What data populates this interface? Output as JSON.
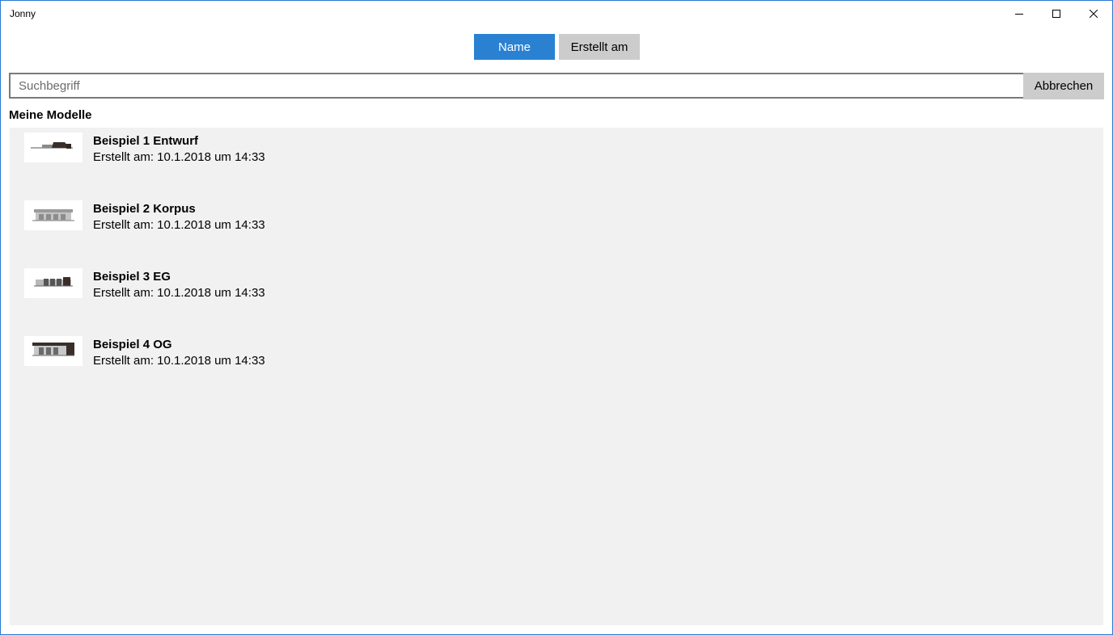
{
  "window": {
    "title": "Jonny"
  },
  "sort": {
    "name_label": "Name",
    "date_label": "Erstellt am"
  },
  "search": {
    "placeholder": "Suchbegriff",
    "cancel_label": "Abbrechen"
  },
  "section": {
    "title": "Meine Modelle"
  },
  "models": [
    {
      "name": "Beispiel 1 Entwurf",
      "created": "Erstellt am: 10.1.2018 um 14:33",
      "thumb_icon": "building-sketch-icon"
    },
    {
      "name": "Beispiel 2 Korpus",
      "created": "Erstellt am: 10.1.2018 um 14:33",
      "thumb_icon": "building-shell-icon"
    },
    {
      "name": "Beispiel 3 EG",
      "created": "Erstellt am: 10.1.2018 um 14:33",
      "thumb_icon": "building-ground-floor-icon"
    },
    {
      "name": "Beispiel 4 OG",
      "created": "Erstellt am: 10.1.2018 um 14:33",
      "thumb_icon": "building-upper-floor-icon"
    }
  ],
  "colors": {
    "accent": "#2a81d2",
    "window_border": "#2b79d0",
    "list_bg": "#f1f1f1",
    "button_gray": "#cccccc"
  }
}
